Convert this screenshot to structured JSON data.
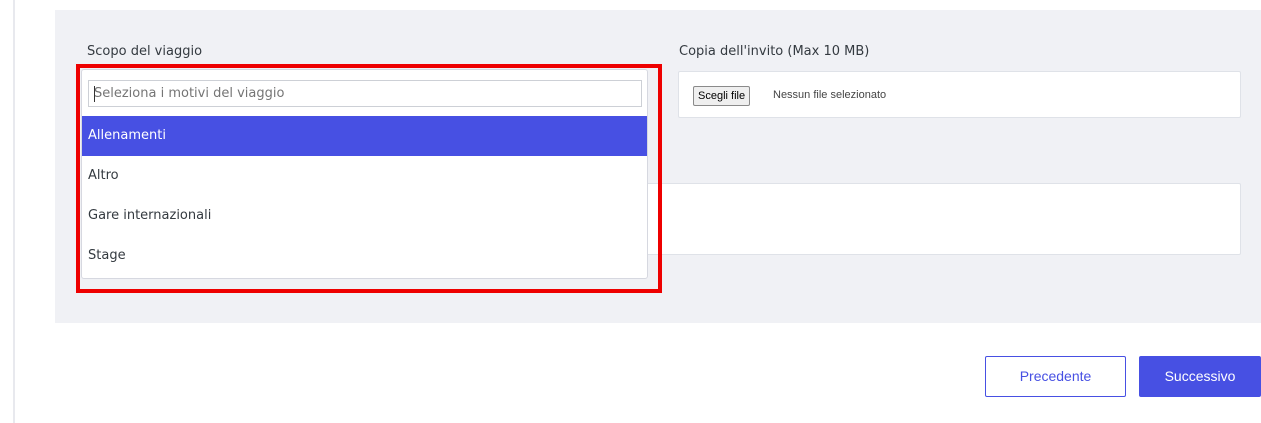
{
  "form": {
    "scope_label": "Scopo del viaggio",
    "scope_placeholder": "Seleziona i motivi del viaggio",
    "scope_options": [
      {
        "label": "Allenamenti",
        "highlighted": true
      },
      {
        "label": "Altro",
        "highlighted": false
      },
      {
        "label": "Gare internazionali",
        "highlighted": false
      },
      {
        "label": "Stage",
        "highlighted": false
      }
    ],
    "invite_label": "Copia dell'invito (Max 10 MB)",
    "file_button_label": "Scegli file",
    "file_status": "Nessun file selezionato"
  },
  "nav": {
    "prev_label": "Precedente",
    "next_label": "Successivo"
  },
  "colors": {
    "accent": "#4750e3",
    "highlight_frame": "#ee0000",
    "card_bg": "#f0f1f5"
  }
}
